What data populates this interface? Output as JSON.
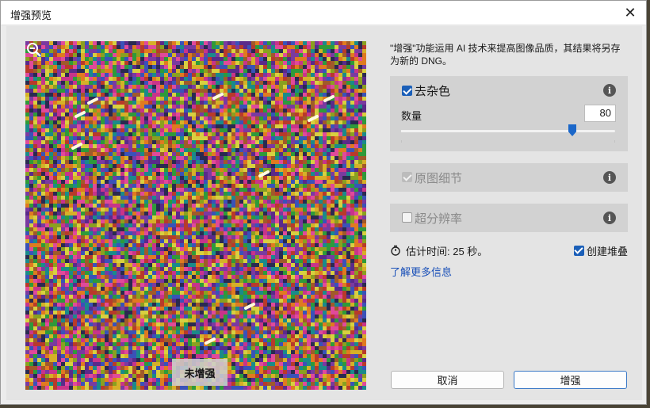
{
  "window": {
    "title": "增强预览",
    "close_glyph": "✕"
  },
  "preview": {
    "badge_label": "未增强",
    "zoom_icon": "zoom-out-icon",
    "noise_palette": [
      "#c8348a",
      "#2e9a3a",
      "#d6b028",
      "#3a52b8",
      "#b83a2a",
      "#5a2a8a",
      "#e07a20",
      "#1a8a8a",
      "#8aa020",
      "#7a3aa0",
      "#d8d040",
      "#e04a9a",
      "#2a2a50",
      "#a05a2a"
    ]
  },
  "description": "\"增强\"功能运用 AI 技术来提高图像品质，其结果将另存为新的 DNG。",
  "denoise": {
    "label": "去杂色",
    "checked": true,
    "amount_label": "数量",
    "amount_value": "80",
    "slider_fraction": 0.8
  },
  "raw_details": {
    "label": "原图细节",
    "checked": true,
    "disabled": true
  },
  "super_resolution": {
    "label": "超分辨率",
    "checked": false
  },
  "info_glyph": "i",
  "estimate": {
    "icon": "stopwatch-icon",
    "text": "估计时间: 25 秒。"
  },
  "create_stack": {
    "label": "创建堆叠",
    "checked": true
  },
  "learn_more": "了解更多信息",
  "buttons": {
    "cancel": "取消",
    "enhance": "增强"
  },
  "colors": {
    "accent": "#1b5fb8",
    "link": "#1a50b8",
    "section_bg": "#d2d2d2"
  }
}
